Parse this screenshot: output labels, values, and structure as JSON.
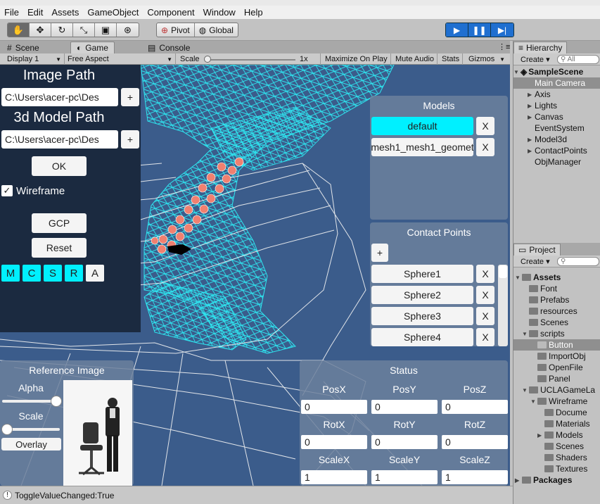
{
  "menu": [
    "File",
    "Edit",
    "Assets",
    "GameObject",
    "Component",
    "Window",
    "Help"
  ],
  "toolbar": {
    "pivot_label": "Pivot",
    "global_label": "Global"
  },
  "tabs": {
    "scene": "Scene",
    "game": "Game",
    "console": "Console"
  },
  "gamebar": {
    "display": "Display 1",
    "aspect": "Free Aspect",
    "scale_label": "Scale",
    "scale_value": "1x",
    "maximize": "Maximize On Play",
    "mute": "Mute Audio",
    "stats": "Stats",
    "gizmos": "Gizmos"
  },
  "left_panel": {
    "image_path_label": "Image Path",
    "image_path_value": "C:\\Users\\acer-pc\\Des",
    "model_path_label": "3d Model Path",
    "model_path_value": "C:\\Users\\acer-pc\\Des",
    "plus": "+",
    "ok": "OK",
    "wireframe_label": "Wireframe",
    "gcp": "GCP",
    "reset": "Reset",
    "mode_buttons": [
      "M",
      "C",
      "S",
      "R",
      "A"
    ]
  },
  "reference_panel": {
    "title": "Reference Image",
    "alpha": "Alpha",
    "scale": "Scale",
    "overlay": "Overlay",
    "alpha_level": 1.0,
    "scale_level": 0.0
  },
  "models_panel": {
    "title": "Models",
    "items": [
      {
        "name": "default",
        "close": "X"
      },
      {
        "name": "mesh1_mesh1_geomet",
        "close": "X"
      }
    ]
  },
  "contact_panel": {
    "title": "Contact Points",
    "add": "+",
    "items": [
      {
        "name": "Sphere1",
        "close": "X"
      },
      {
        "name": "Sphere2",
        "close": "X"
      },
      {
        "name": "Sphere3",
        "close": "X"
      },
      {
        "name": "Sphere4",
        "close": "X"
      }
    ]
  },
  "status_panel": {
    "title": "Status",
    "rows": [
      {
        "labels": [
          "PosX",
          "PosY",
          "PosZ"
        ],
        "values": [
          "0",
          "0",
          "0"
        ]
      },
      {
        "labels": [
          "RotX",
          "RotY",
          "RotZ"
        ],
        "values": [
          "0",
          "0",
          "0"
        ]
      },
      {
        "labels": [
          "ScaleX",
          "ScaleY",
          "ScaleZ"
        ],
        "values": [
          "1",
          "1",
          "1"
        ]
      }
    ]
  },
  "hierarchy": {
    "tab": "Hierarchy",
    "create": "Create",
    "search": "All",
    "scene": "SampleScene",
    "items": [
      "Main Camera",
      "Axis",
      "Lights",
      "Canvas",
      "EventSystem",
      "Model3d",
      "ContactPoints",
      "ObjManager"
    ]
  },
  "project": {
    "tab": "Project",
    "create": "Create",
    "items": [
      "Assets",
      "Font",
      "Prefabs",
      "resources",
      "Scenes",
      "scripts",
      "Button",
      "ImportObj",
      "OpenFile",
      "Panel",
      "UCLAGameLa",
      "Wireframe",
      "Docume",
      "Materials",
      "Models",
      "Scenes",
      "Shaders",
      "Textures",
      "Packages"
    ]
  },
  "status_bar": {
    "message": "ToggleValueChanged:True"
  },
  "colors": {
    "accent_cyan": "#00f0ff",
    "play_blue": "#1f6fd0",
    "scene_bg": "#3b5c8b",
    "dark_panel": "#1b2a40",
    "wire_cyan": "#2ee6f0"
  }
}
